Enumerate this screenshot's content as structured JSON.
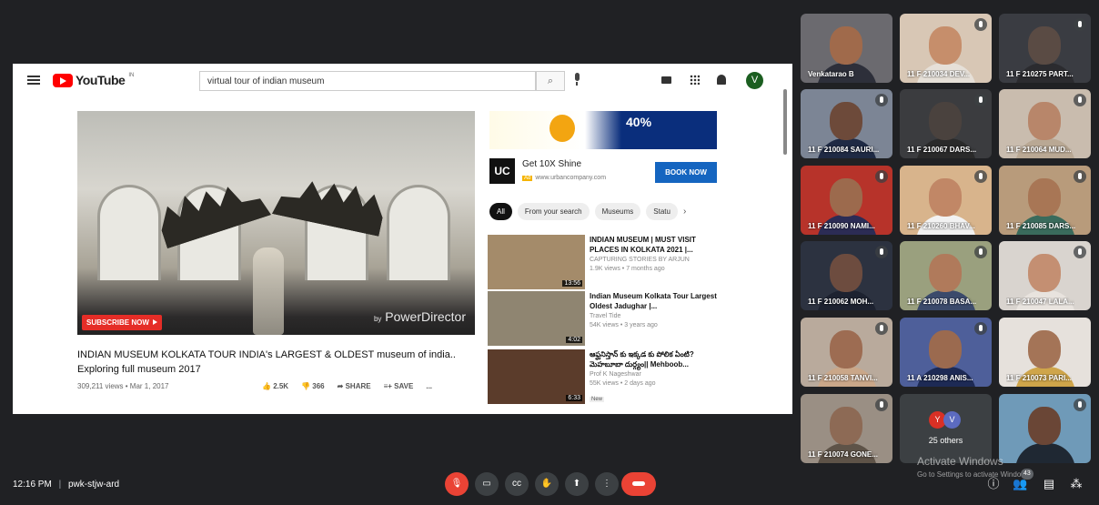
{
  "youtube": {
    "logo_text": "YouTube",
    "logo_sup": "IN",
    "search_query": "virtual tour of indian museum",
    "search_icon": "⌕",
    "avatar_letter": "V"
  },
  "video": {
    "subscribe_label": "SUBSCRIBE NOW",
    "watermark_small": "by",
    "watermark": "PowerDirector",
    "title": "INDIAN MUSEUM KOLKATA TOUR INDIA's LARGEST & OLDEST museum of india.. Exploring full museum 2017",
    "meta": "309,211 views • Mar 1, 2017",
    "likes": "2.5K",
    "dislikes": "366",
    "share_label": "SHARE",
    "save_label": "SAVE",
    "more_label": "..."
  },
  "ad": {
    "percent": "40%",
    "logo_letters": "UC",
    "title": "Get 10X Shine",
    "tag": "Ad",
    "url": "www.urbancompany.com",
    "cta": "BOOK NOW"
  },
  "chips": [
    "All",
    "From your search",
    "Museums",
    "Statu"
  ],
  "chips_next": "›",
  "recommendations": [
    {
      "title": "INDIAN MUSEUM | MUST VISIT PLACES IN KOLKATA 2021 |...",
      "channel": "CAPTURING STORIES BY ARJUN",
      "stats": "1.9K views • 7 months ago",
      "duration": "13:56",
      "thumb_color": "#a48b6a"
    },
    {
      "title": "Indian Museum Kolkata Tour Largest Oldest Jadughar |...",
      "channel": "Travel Tide",
      "stats": "54K views • 3 years ago",
      "duration": "4:02",
      "thumb_color": "#8f8571"
    },
    {
      "title": "ఆఫ్ఘనిస్తాన్ కు ఇక్కడ కు పోలిక ఏంటి? మెహబూబా దుర్గ్యం|| Mehboob...",
      "channel": "Prof K Nageshwar",
      "stats": "55K views • 2 days ago",
      "duration": "6:33",
      "badge": "New",
      "thumb_color": "#5b3c2b"
    }
  ],
  "participants": [
    {
      "name": "Venkatarao B",
      "muted": false,
      "bg": "#6b6a6f",
      "skin": "#a06a4b",
      "shirt": "#2d2f3a"
    },
    {
      "name": "11 F 210034 DEV...",
      "muted": true,
      "bg": "#d8c7b5",
      "skin": "#c68e6b",
      "shirt": "#e6e0d8"
    },
    {
      "name": "11 F 210275 PART...",
      "muted": true,
      "bg": "#3a3c42",
      "skin": "#5a4b44",
      "shirt": "#2b2b2f"
    },
    {
      "name": "11 F 210084 SAURI...",
      "muted": true,
      "bg": "#7c8595",
      "skin": "#6d4a3a",
      "shirt": "#1f2a44"
    },
    {
      "name": "11 F 210067 DARS...",
      "muted": true,
      "bg": "#3b3c3f",
      "skin": "#4a423e",
      "shirt": "#2a2a2a"
    },
    {
      "name": "11 F 210064 MUD...",
      "muted": true,
      "bg": "#c9bcae",
      "skin": "#b8866a",
      "shirt": "#b9a894"
    },
    {
      "name": "11 F 210090 NAMI...",
      "muted": true,
      "bg": "#b7332a",
      "skin": "#9c6a4d",
      "shirt": "#2c2c55"
    },
    {
      "name": "11 F 210260 BHAV...",
      "muted": true,
      "bg": "#d8b48c",
      "skin": "#c18766",
      "shirt": "#f2f2f2"
    },
    {
      "name": "11 F 210085 DARS...",
      "muted": true,
      "bg": "#b89b7b",
      "skin": "#a87655",
      "shirt": "#3a6b5c"
    },
    {
      "name": "11 F 210062 MOH...",
      "muted": true,
      "bg": "#2c3240",
      "skin": "#6d4c3f",
      "shirt": "#1d2230"
    },
    {
      "name": "11 F 210078 BASA...",
      "muted": true,
      "bg": "#9aa07e",
      "skin": "#b07a5b",
      "shirt": "#3b4a6b"
    },
    {
      "name": "11 F 210047 LALA...",
      "muted": true,
      "bg": "#d9d4cf",
      "skin": "#c48f72",
      "shirt": "#e8e3de"
    },
    {
      "name": "11 F 210058 TANVI...",
      "muted": true,
      "bg": "#b9aa9c",
      "skin": "#9d6c52",
      "shirt": "#caa789"
    },
    {
      "name": "11 A 210298 ANIS...",
      "muted": true,
      "bg": "#4e5f9a",
      "skin": "#9b6a4f",
      "shirt": "#1d2a55"
    },
    {
      "name": "11 F 210073 PARI...",
      "muted": false,
      "bg": "#e6e1dc",
      "skin": "#a47457",
      "shirt": "#cfa54a"
    },
    {
      "name": "11 F 210074 GONE...",
      "muted": true,
      "bg": "#9a8f84",
      "skin": "#8d6a55",
      "shirt": "#5e5348"
    },
    {
      "name": "",
      "muted": true,
      "bg": "#6f9ab8",
      "skin": "#6a4636",
      "shirt": "#1f2833"
    }
  ],
  "others": {
    "avatar1": "Y",
    "avatar2": "V",
    "avatar1_color": "#d93025",
    "avatar2_color": "#5c6bc0",
    "label": "25 others"
  },
  "watermark": {
    "line1": "Activate Windows",
    "line2": "Go to Settings to activate Windows."
  },
  "meeting": {
    "time": "12:16 PM",
    "separator": "|",
    "code": "pwk-stjw-ard",
    "participant_count": "43"
  },
  "colors": {
    "meet_bg": "#202124",
    "danger": "#ea4335",
    "yt_red": "#ff0000"
  }
}
